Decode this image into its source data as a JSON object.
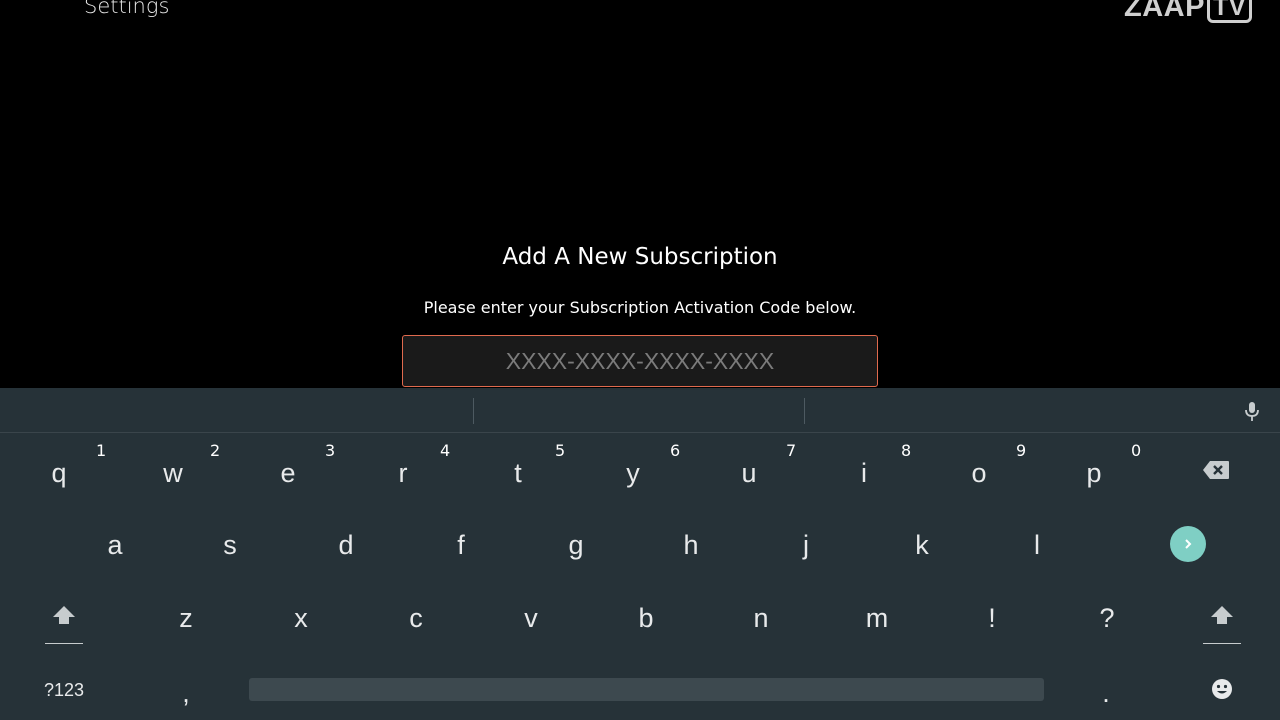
{
  "header": {
    "title": "Settings",
    "logo_main": "ZAAP",
    "logo_tv": "TV"
  },
  "dialog": {
    "title": "Add A New Subscription",
    "subtitle": "Please enter your Subscription Activation Code below.",
    "input_placeholder": "XXXX-XXXX-XXXX-XXXX",
    "input_value": ""
  },
  "keyboard": {
    "row1": [
      {
        "key": "q",
        "hint": "1"
      },
      {
        "key": "w",
        "hint": "2"
      },
      {
        "key": "e",
        "hint": "3"
      },
      {
        "key": "r",
        "hint": "4"
      },
      {
        "key": "t",
        "hint": "5"
      },
      {
        "key": "y",
        "hint": "6"
      },
      {
        "key": "u",
        "hint": "7"
      },
      {
        "key": "i",
        "hint": "8"
      },
      {
        "key": "o",
        "hint": "9"
      },
      {
        "key": "p",
        "hint": "0"
      }
    ],
    "row2": [
      "a",
      "s",
      "d",
      "f",
      "g",
      "h",
      "j",
      "k",
      "l"
    ],
    "row3": [
      "z",
      "x",
      "c",
      "v",
      "b",
      "n",
      "m",
      "!",
      "?"
    ],
    "symbols_label": "?123",
    "comma": ",",
    "period": ".",
    "icons": {
      "backspace": "backspace-icon",
      "enter": "chevron-right-icon",
      "shift": "shift-icon",
      "emoji": "emoji-icon",
      "mic": "microphone-icon"
    },
    "colors": {
      "background": "#263238",
      "enter_accent": "#7fcfc4",
      "input_border": "#e06a4e"
    }
  }
}
